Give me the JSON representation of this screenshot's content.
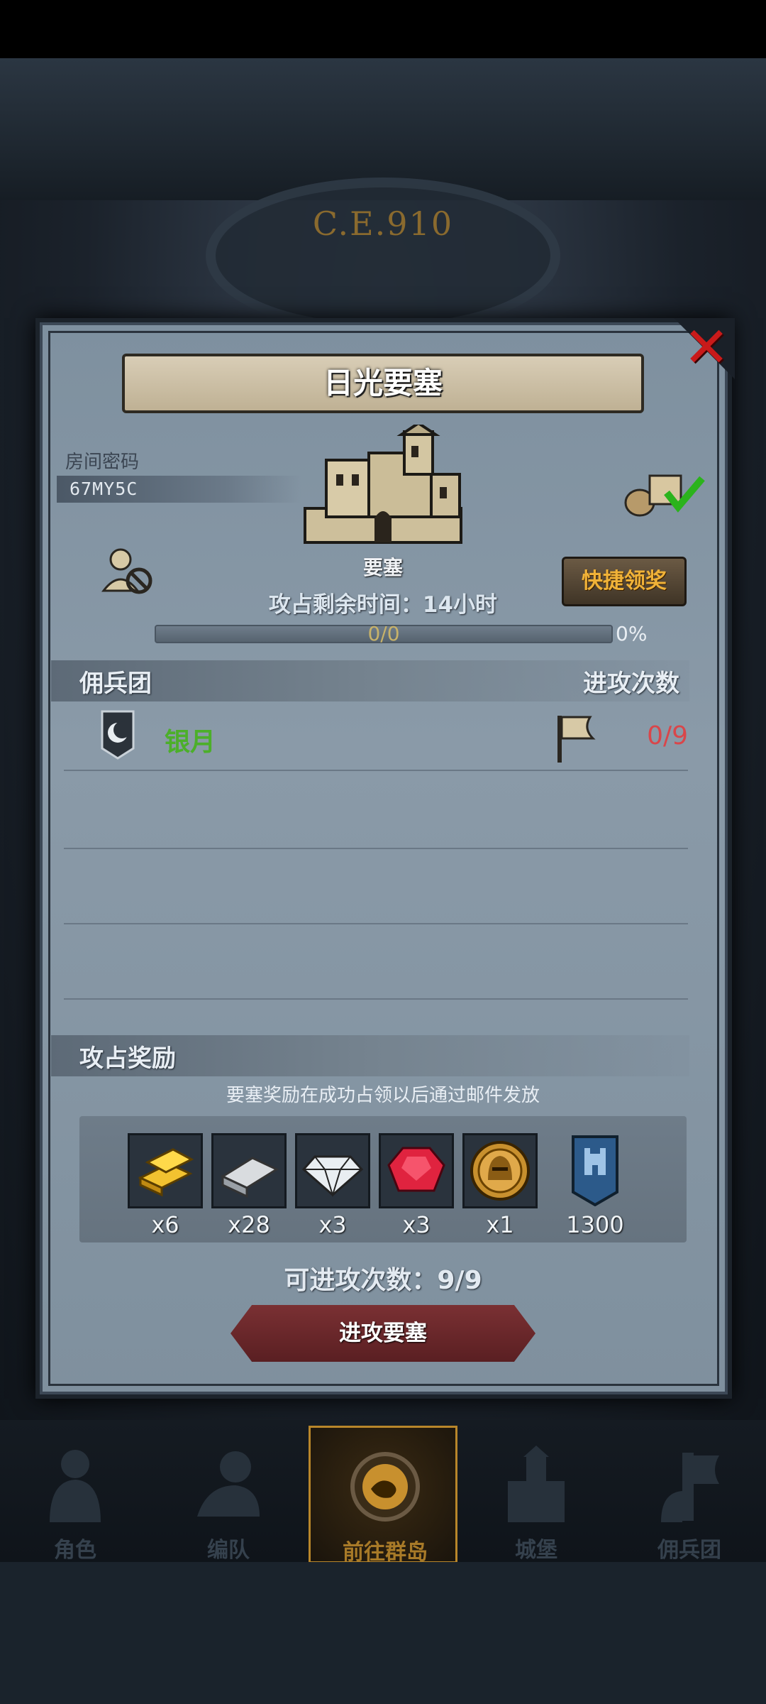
{
  "background": {
    "era_label": "C.E.910"
  },
  "dialog": {
    "title": "日光要塞",
    "close_label": "✕",
    "room_code_label": "房间密码",
    "room_code_value": "67MY5C",
    "fortress_label": "要塞",
    "quick_claim_label": "快捷领奖",
    "remaining_time": "攻占剩余时间：14小时",
    "progress_text": "0/0",
    "progress_percent": "0%",
    "progress_value": 0,
    "mercenary_header": "佣兵团",
    "attack_count_header": "进攻次数",
    "mercenaries": [
      {
        "name": "银月",
        "attack_count": "0/9"
      }
    ],
    "reward_header": "攻占奖励",
    "reward_note": "要塞奖励在成功占领以后通过邮件发放",
    "rewards": [
      {
        "icon": "gold-bar-icon",
        "count": "x6"
      },
      {
        "icon": "iron-ingot-icon",
        "count": "x28"
      },
      {
        "icon": "diamond-icon",
        "count": "x3"
      },
      {
        "icon": "ruby-icon",
        "count": "x3"
      },
      {
        "icon": "helmet-coin-icon",
        "count": "x1"
      },
      {
        "icon": "fortress-banner-icon",
        "count": "1300"
      }
    ],
    "attacks_left": "可进攻次数：9/9",
    "attack_button_label": "进攻要塞"
  },
  "bottom_nav": {
    "items": [
      {
        "label": "角色",
        "icon": "knight-icon",
        "active": false
      },
      {
        "label": "编队",
        "icon": "squad-icon",
        "active": false
      },
      {
        "label": "前往群岛",
        "icon": "compass-map-icon",
        "active": true
      },
      {
        "label": "城堡",
        "icon": "castle-icon",
        "active": false
      },
      {
        "label": "佣兵团",
        "icon": "mercenary-icon",
        "active": false
      }
    ]
  },
  "colors": {
    "accent_gold": "#f0b238",
    "merc_green": "#4caf2a",
    "attack_red": "#d9464a",
    "close_red": "#c91a1a"
  }
}
